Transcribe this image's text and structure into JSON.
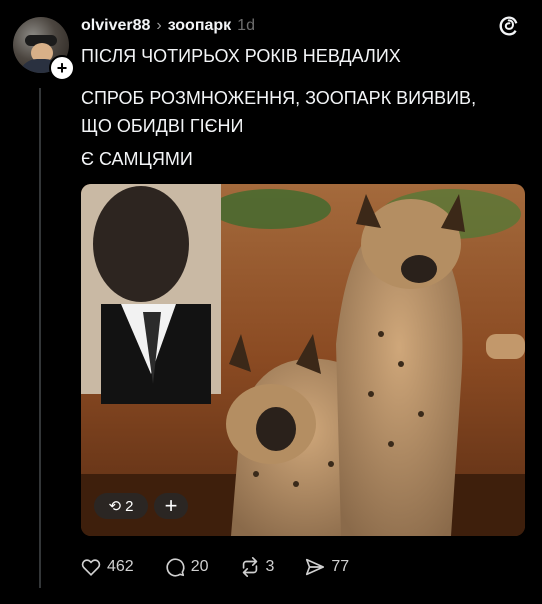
{
  "post": {
    "username": "olviver88",
    "topic": "зоопарк",
    "time": "1d",
    "text_line1": "ПІСЛЯ ЧОТИРЬОХ РОКІВ НЕВДАЛИХ",
    "text_line2": "СПРОБ РОЗМНОЖЕННЯ, ЗООПАРК ВИЯВИВ,\nЩО ОБИДВІ ГІЄНИ",
    "text_line3": "Є САМЦЯМИ"
  },
  "image": {
    "repost_count": "2",
    "add_label": "+"
  },
  "actions": {
    "likes": "462",
    "replies": "20",
    "reposts": "3",
    "shares": "77"
  }
}
